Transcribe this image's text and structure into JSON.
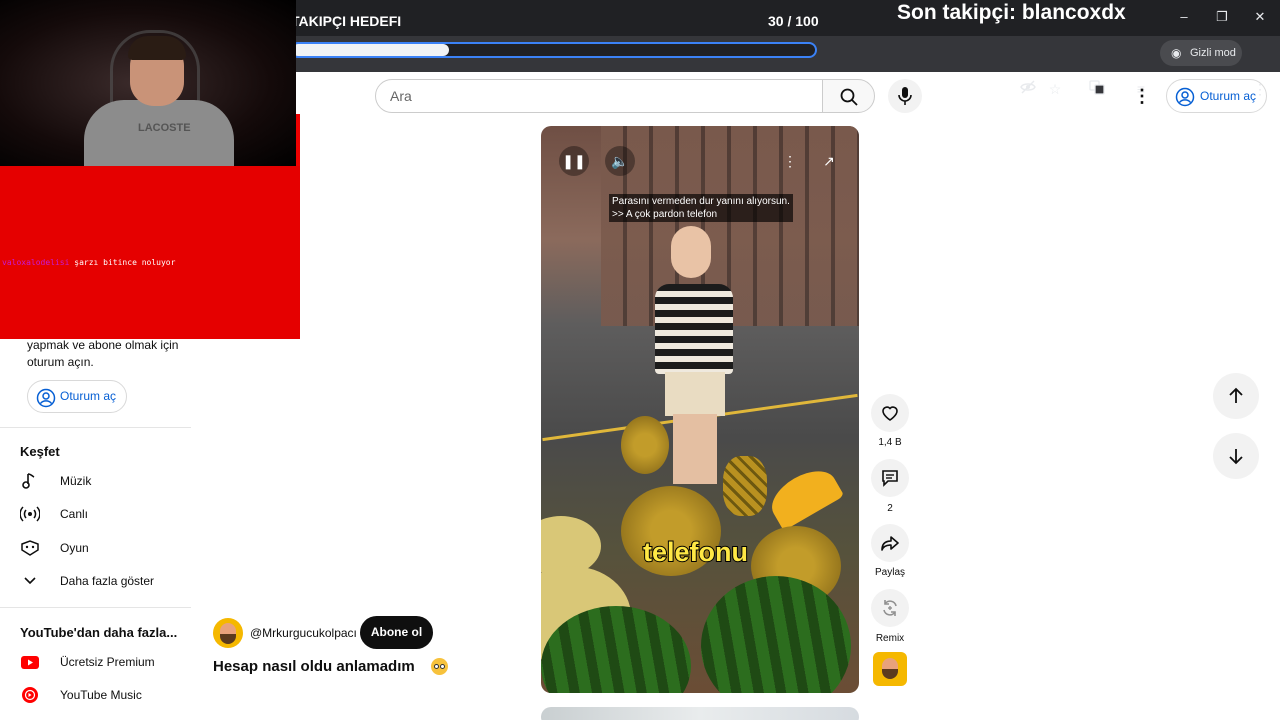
{
  "stream_overlay": {
    "goal_title": "TAKIPÇI HEDEFI",
    "goal_count": "30 / 100",
    "goal_progress": 0.3,
    "last_follower": "Son takipçi: blancoxdx",
    "chat_user": "valoxalodelisi",
    "chat_message": "şarzı bitince noluyor",
    "webcam_shirt_text": "LACOSTE"
  },
  "browser": {
    "incognito_label": "Gizli mod",
    "window_controls": [
      "minimize-icon",
      "restore-icon",
      "close-icon"
    ],
    "toolbar_icons": [
      "eye-off-icon",
      "star-icon",
      "translate-icon",
      "reading-list-icon",
      "incognito-icon",
      "kebab-icon"
    ]
  },
  "header": {
    "search_placeholder": "Ara",
    "signin_label": "Oturum aç"
  },
  "sidebar": {
    "signin_text": "yapmak ve abone olmak için oturum açın.",
    "signin_button": "Oturum aç",
    "explore_title": "Keşfet",
    "explore_items": [
      {
        "label": "Müzik",
        "icon": "music-note-icon"
      },
      {
        "label": "Canlı",
        "icon": "live-icon"
      },
      {
        "label": "Oyun",
        "icon": "gamepad-icon"
      },
      {
        "label": "Daha fazla göster",
        "icon": "chevron-down-icon"
      }
    ],
    "more_title": "YouTube'dan daha fazla...",
    "more_items": [
      {
        "label": "Ücretsiz Premium",
        "icon": "youtube-premium-icon"
      },
      {
        "label": "YouTube Music",
        "icon": "youtube-music-icon"
      }
    ]
  },
  "video": {
    "subtitle_line1": "Parasını vermeden dur yanını alıyorsun.",
    "subtitle_line2": ">> A çok pardon telefon",
    "caption": "telefonu",
    "channel_handle": "@Mrkurgucukolpacı",
    "subscribe_label": "Abone ol",
    "title": "Hesap nasıl oldu anlamadım"
  },
  "actions": {
    "likes": "1,4 B",
    "comments": "2",
    "share": "Paylaş",
    "remix": "Remix"
  },
  "colors": {
    "accent_blue": "#065fd4",
    "overlay_red": "#e50000",
    "youtube_red": "#ff0000"
  }
}
